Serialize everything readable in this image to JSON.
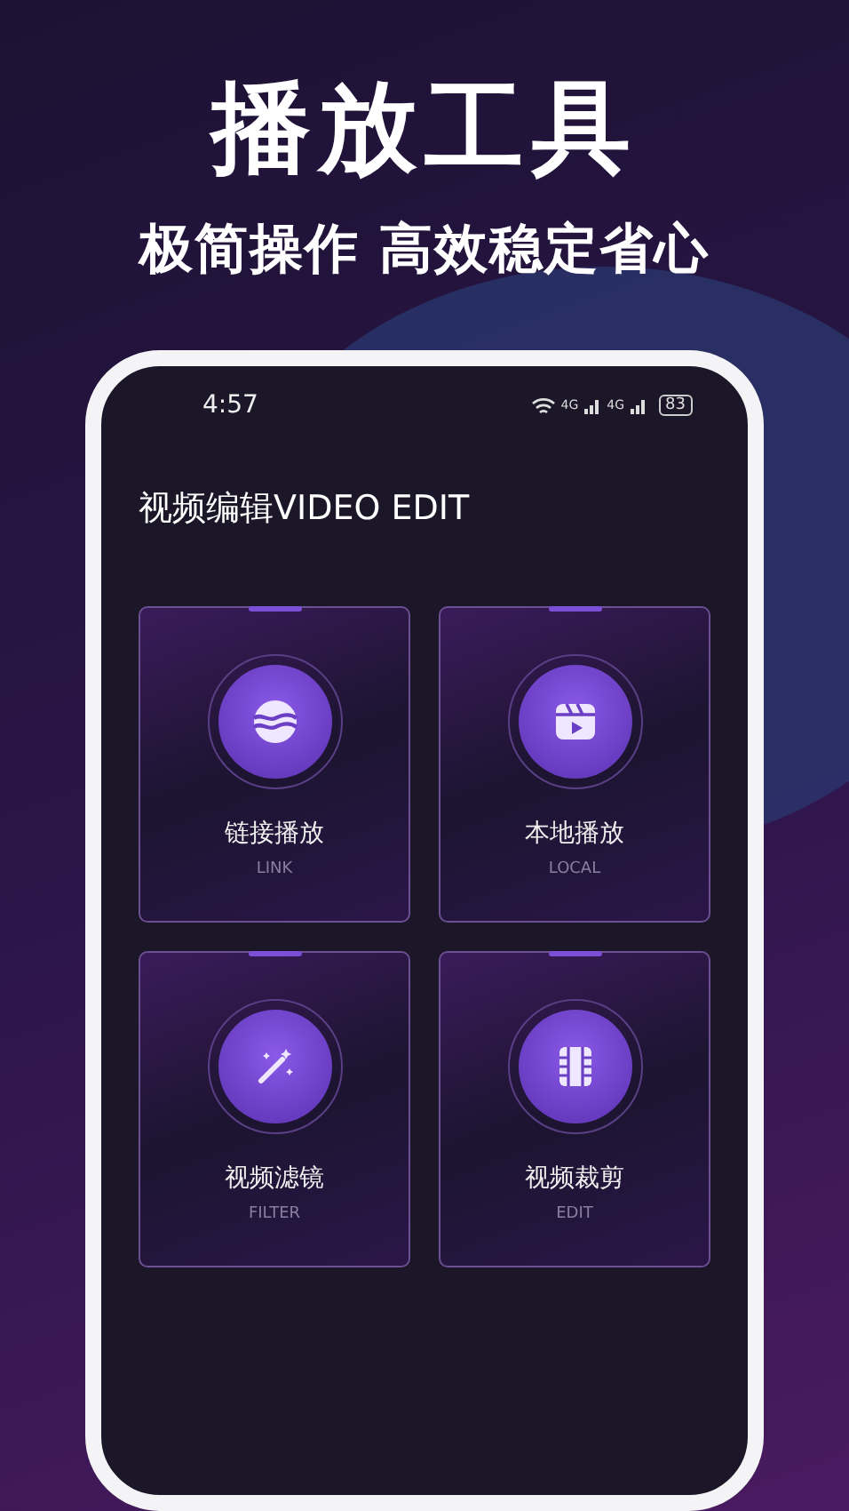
{
  "headline": "播放工具",
  "subheadline": "极简操作 高效稳定省心",
  "status_bar": {
    "time": "4:57",
    "network_1": "4G",
    "network_2": "4G",
    "battery": "83"
  },
  "page_title": "视频编辑VIDEO EDIT",
  "tools": [
    {
      "kind": "link",
      "title": "链接播放",
      "subtitle": "LINK"
    },
    {
      "kind": "local",
      "title": "本地播放",
      "subtitle": "LOCAL"
    },
    {
      "kind": "filter",
      "title": "视频滤镜",
      "subtitle": "FILTER"
    },
    {
      "kind": "edit",
      "title": "视频裁剪",
      "subtitle": "EDIT"
    }
  ]
}
